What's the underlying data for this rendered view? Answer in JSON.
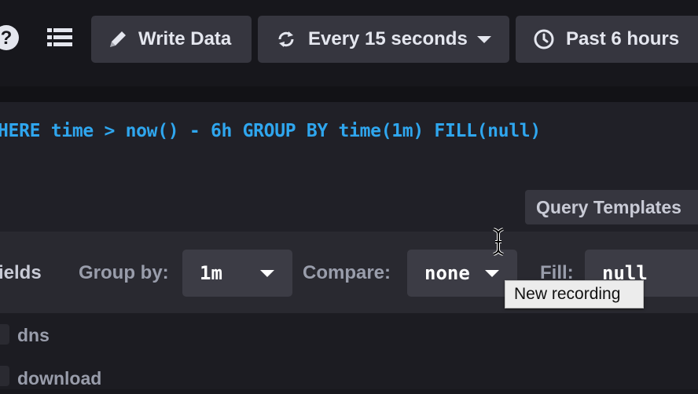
{
  "header": {
    "help_icon": "question-circle-icon",
    "menu_icon": "list-icon",
    "write_data": {
      "icon": "pencil-icon",
      "label": "Write Data"
    },
    "refresh": {
      "icon": "refresh-icon",
      "label": "Every 15 seconds",
      "caret_icon": "caret-down-icon"
    },
    "time_range": {
      "icon": "clock-icon",
      "label": "Past 6 hours"
    }
  },
  "editor": {
    "query_text": "HERE time > now() - 6h GROUP BY time(1m) FILL(null)",
    "templates_button": "Query Templates"
  },
  "builder": {
    "fields_label": "ields",
    "group_by": {
      "label": "Group by:",
      "value": "1m"
    },
    "compare": {
      "label": "Compare:",
      "value": "none"
    },
    "fill": {
      "label": "Fill:",
      "value": "null"
    }
  },
  "measurements": {
    "items": [
      {
        "label": "dns"
      },
      {
        "label": "download"
      }
    ]
  },
  "tooltip": {
    "text": "New recording"
  },
  "colors": {
    "query_text": "#2fa6ee",
    "button_bg": "#36363f",
    "page_bg": "#18181d",
    "tooltip_bg": "#ececec"
  }
}
